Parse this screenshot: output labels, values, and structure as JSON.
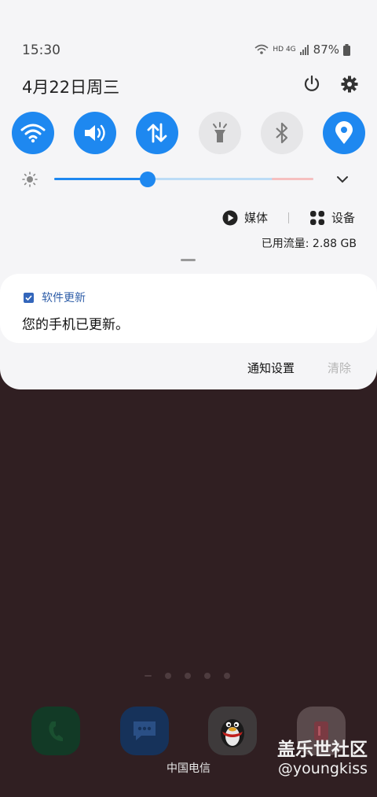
{
  "status": {
    "time": "15:30",
    "signal_text": "HD 4G",
    "battery": "87%"
  },
  "date": "4月22日周三",
  "quick_tiles": [
    {
      "name": "wifi-icon",
      "on": true
    },
    {
      "name": "sound-icon",
      "on": true
    },
    {
      "name": "mobile-data-icon",
      "on": true
    },
    {
      "name": "flashlight-icon",
      "on": false
    },
    {
      "name": "bluetooth-icon",
      "on": false
    },
    {
      "name": "location-icon",
      "on": true
    }
  ],
  "brightness": {
    "level": 0.36
  },
  "media": {
    "media_label": "媒体",
    "devices_label": "设备"
  },
  "usage": "已用流量: 2.88 GB",
  "notification": {
    "app_name": "软件更新",
    "message": "您的手机已更新。"
  },
  "actions": {
    "settings": "通知设置",
    "clear": "清除"
  },
  "carrier": "中国电信",
  "watermark": {
    "line1": "盖乐世社区",
    "line2": "@youngkiss"
  },
  "colors": {
    "accent": "#1e88f0",
    "panel": "#f5f5f7",
    "wallpaper": "#301f22"
  }
}
